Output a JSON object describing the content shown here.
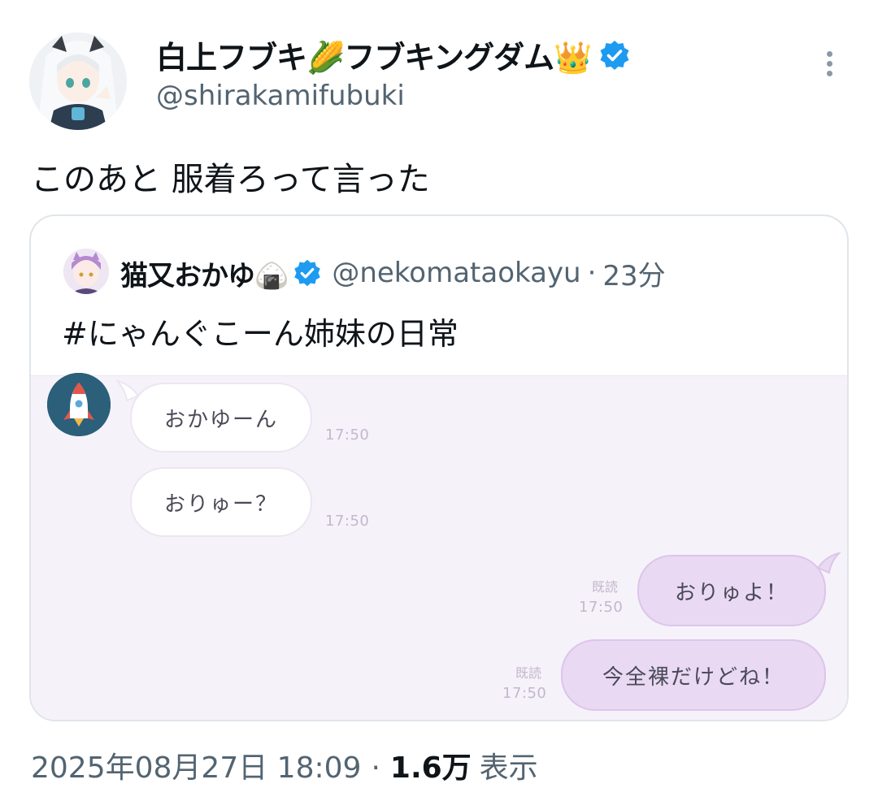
{
  "author": {
    "display_name": "白上フブキ🌽フブキングダム👑",
    "handle": "@shirakamifubuki",
    "verified_icon": "verified-badge-icon",
    "colors": {
      "verified": "#1d9bf0",
      "handle": "#536471"
    }
  },
  "tweet": {
    "text": "このあと 服着ろって言った"
  },
  "quoted_tweet": {
    "display_name": "猫又おかゆ🍙",
    "handle": "@nekomataokayu",
    "separator": "·",
    "time_ago": "23分",
    "text": "#にゃんぐこーん姉妹の日常",
    "chat": {
      "incoming": [
        {
          "text": "おかゆーん",
          "time": "17:50"
        },
        {
          "text": "おりゅー？",
          "time": "17:50"
        }
      ],
      "outgoing": [
        {
          "text": "おりゅよ！",
          "read": "既読",
          "time": "17:50"
        },
        {
          "text": "今全裸だけどね！",
          "read": "既読",
          "time": "17:50"
        }
      ]
    }
  },
  "meta": {
    "timestamp": "2025年08月27日 18:09",
    "separator": "·",
    "view_count": "1.6万",
    "view_label": "表示"
  }
}
